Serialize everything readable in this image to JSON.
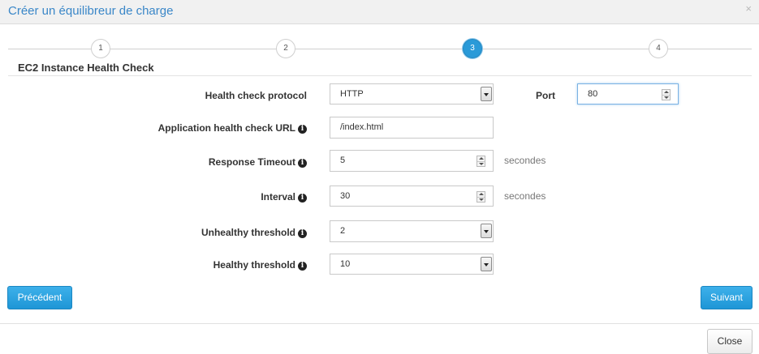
{
  "dialog": {
    "title": "Créer un équilibreur de charge",
    "close_glyph": "×"
  },
  "stepper": {
    "steps": [
      "1",
      "2",
      "3",
      "4"
    ],
    "active_step": "3"
  },
  "section": {
    "title": "EC2 Instance Health Check"
  },
  "form": {
    "protocol": {
      "label": "Health check protocol",
      "value": "HTTP"
    },
    "port": {
      "label": "Port",
      "value": "80"
    },
    "url": {
      "label": "Application health check URL",
      "value": "/index.html"
    },
    "timeout": {
      "label": "Response Timeout",
      "value": "5",
      "unit": "secondes"
    },
    "interval": {
      "label": "Interval",
      "value": "30",
      "unit": "secondes"
    },
    "unhealthy": {
      "label": "Unhealthy threshold",
      "value": "2"
    },
    "healthy": {
      "label": "Healthy threshold",
      "value": "10"
    },
    "info_glyph": "i"
  },
  "buttons": {
    "previous": "Précédent",
    "next": "Suivant",
    "close": "Close"
  },
  "colors": {
    "accent": "#2a9ad8",
    "title": "#3a87c8"
  }
}
